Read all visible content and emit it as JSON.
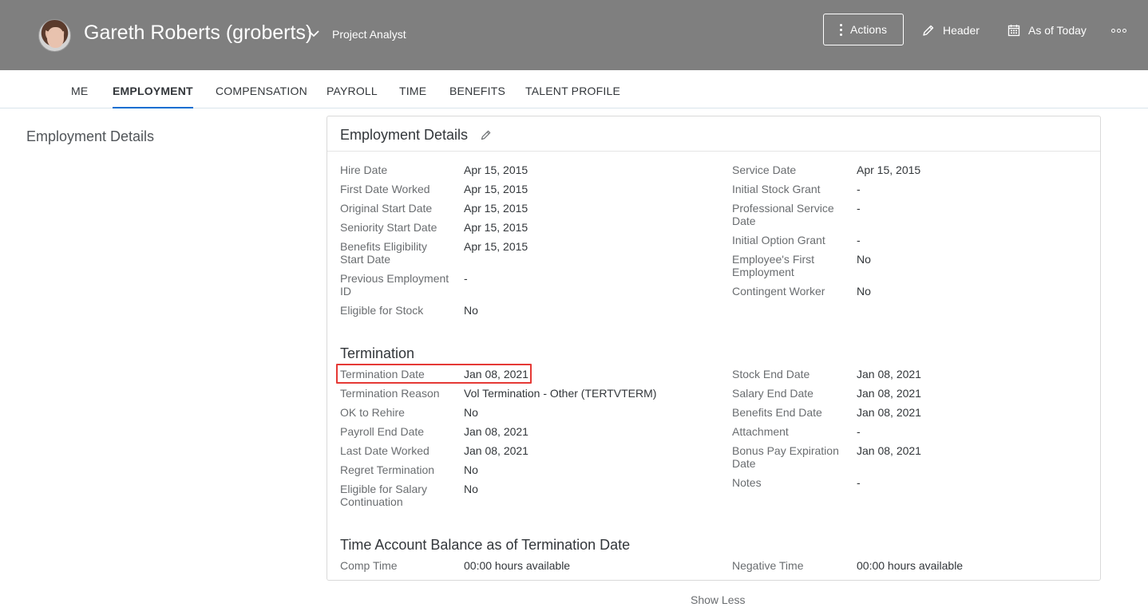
{
  "header": {
    "user_name": "Gareth Roberts (groberts)",
    "user_title": "Project Analyst",
    "actions_label": "Actions",
    "header_label": "Header",
    "as_of_label": "As of Today"
  },
  "tabs": [
    "ME",
    "EMPLOYMENT",
    "COMPENSATION",
    "PAYROLL",
    "TIME",
    "BENEFITS",
    "TALENT PROFILE"
  ],
  "active_tab": "EMPLOYMENT",
  "side_title": "Employment Details",
  "card": {
    "title": "Employment Details",
    "details_left": [
      {
        "label": "Hire Date",
        "value": "Apr 15, 2015"
      },
      {
        "label": "First Date Worked",
        "value": "Apr 15, 2015"
      },
      {
        "label": "Original Start Date",
        "value": "Apr 15, 2015"
      },
      {
        "label": "Seniority Start Date",
        "value": "Apr 15, 2015"
      },
      {
        "label": "Benefits Eligibility Start Date",
        "value": "Apr 15, 2015"
      },
      {
        "label": "Previous Employment ID",
        "value": "-"
      },
      {
        "label": "Eligible for Stock",
        "value": "No"
      }
    ],
    "details_right": [
      {
        "label": "Service Date",
        "value": "Apr 15, 2015"
      },
      {
        "label": "Initial Stock Grant",
        "value": "-"
      },
      {
        "label": "Professional Service Date",
        "value": "-"
      },
      {
        "label": "Initial Option Grant",
        "value": "-"
      },
      {
        "label": "Employee's First Employment",
        "value": "No"
      },
      {
        "label": "Contingent Worker",
        "value": "No"
      }
    ],
    "termination_title": "Termination",
    "termination_left": [
      {
        "label": "Termination Date",
        "value": "Jan 08, 2021"
      },
      {
        "label": "Termination Reason",
        "value": "Vol Termination - Other (TERTVTERM)"
      },
      {
        "label": "OK to Rehire",
        "value": "No"
      },
      {
        "label": "Payroll End Date",
        "value": "Jan 08, 2021"
      },
      {
        "label": "Last Date Worked",
        "value": "Jan 08, 2021"
      },
      {
        "label": "Regret Termination",
        "value": "No"
      },
      {
        "label": "Eligible for Salary Continuation",
        "value": "No"
      }
    ],
    "termination_right": [
      {
        "label": "Stock End Date",
        "value": "Jan 08, 2021"
      },
      {
        "label": "Salary End Date",
        "value": "Jan 08, 2021"
      },
      {
        "label": "Benefits End Date",
        "value": "Jan 08, 2021"
      },
      {
        "label": "Attachment",
        "value": "-"
      },
      {
        "label": "Bonus Pay Expiration Date",
        "value": "Jan 08, 2021"
      },
      {
        "label": "Notes",
        "value": "-"
      }
    ],
    "time_title": "Time Account Balance as of Termination Date",
    "time_left": [
      {
        "label": "Comp Time",
        "value": "00:00 hours available"
      }
    ],
    "time_right": [
      {
        "label": "Negative Time",
        "value": "00:00 hours available"
      }
    ]
  },
  "show_less_label": "Show Less",
  "colors": {
    "header_bg": "#7f7f7f",
    "tab_underline": "#0a6ed1",
    "highlight": "#e53935"
  }
}
